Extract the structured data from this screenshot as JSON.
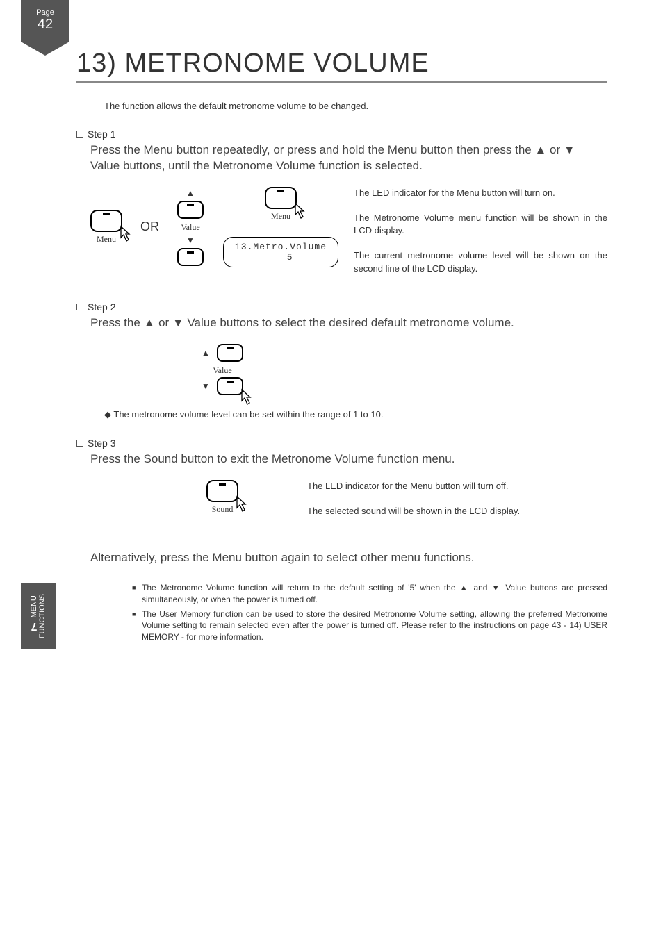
{
  "page": {
    "label": "Page",
    "number": "42"
  },
  "sidebar": {
    "section_number": "7",
    "line1": "MENU",
    "line2": "FUNCTIONS"
  },
  "title": "13) METRONOME VOLUME",
  "intro": "The function allows the default metronome volume to be changed.",
  "step1": {
    "heading": "Step 1",
    "desc": "Press the Menu button repeatedly, or press and hold the Menu button then press the ▲ or ▼ Value buttons, until the Metronome Volume function is selected.",
    "or_label": "OR",
    "btn_menu": "Menu",
    "btn_value": "Value",
    "lcd_line1": "13.Metro.Volume",
    "lcd_line2": "=  5",
    "note1": "The LED indicator for the Menu button will turn on.",
    "note2": "The Metronome Volume menu function will be shown in the LCD display.",
    "note3": "The current metronome volume level will be shown on the second line of the LCD display."
  },
  "step2": {
    "heading": "Step 2",
    "desc": "Press the ▲ or ▼ Value buttons to select the desired default metronome volume.",
    "btn_value": "Value",
    "note": "◆ The metronome volume level can be set within the range of 1 to 10."
  },
  "step3": {
    "heading": "Step 3",
    "desc": "Press the Sound button to exit the Metronome Volume function menu.",
    "btn_sound": "Sound",
    "note1": "The LED indicator for the Menu button will turn off.",
    "note2": "The selected sound will be shown in the LCD display."
  },
  "alt_desc": "Alternatively, press the Menu button again to select other menu functions.",
  "footnotes": {
    "n1": "The Metronome Volume function will return to the default setting of '5' when the ▲ and ▼ Value buttons are pressed simultaneously, or when the power is turned off.",
    "n2": "The User Memory function can be used to store the desired Metronome Volume setting, allowing the preferred Metronome Volume setting to remain selected even after the power is turned off.  Please refer to the instructions on page 43 - 14) USER MEMORY - for more information."
  }
}
